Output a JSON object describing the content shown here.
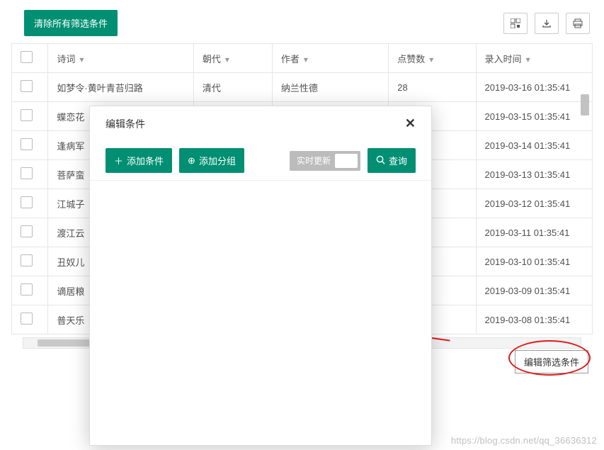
{
  "toolbar": {
    "clear_filters": "清除所有筛选条件"
  },
  "columns": {
    "poem": "诗词",
    "dynasty": "朝代",
    "author": "作者",
    "likes": "点赞数",
    "time": "录入时间"
  },
  "rows": [
    {
      "poem": "如梦令·黄叶青苔归路",
      "dynasty": "清代",
      "author": "纳兰性德",
      "likes": "28",
      "time": "2019-03-16 01:35:41"
    },
    {
      "poem": "蝶恋花",
      "dynasty": "",
      "author": "",
      "likes": "",
      "time": "2019-03-15 01:35:41"
    },
    {
      "poem": "逢病军",
      "dynasty": "",
      "author": "",
      "likes": "",
      "time": "2019-03-14 01:35:41"
    },
    {
      "poem": "菩萨蛮",
      "dynasty": "",
      "author": "",
      "likes": "",
      "time": "2019-03-13 01:35:41"
    },
    {
      "poem": "江城子",
      "dynasty": "",
      "author": "",
      "likes": "",
      "time": "2019-03-12 01:35:41"
    },
    {
      "poem": "渡江云",
      "dynasty": "",
      "author": "",
      "likes": "",
      "time": "2019-03-11 01:35:41"
    },
    {
      "poem": "丑奴儿",
      "dynasty": "",
      "author": "",
      "likes": "",
      "time": "2019-03-10 01:35:41"
    },
    {
      "poem": "谪居粮",
      "dynasty": "",
      "author": "",
      "likes": "",
      "time": "2019-03-09 01:35:41"
    },
    {
      "poem": "普天乐",
      "dynasty": "",
      "author": "",
      "likes": "",
      "time": "2019-03-08 01:35:41"
    }
  ],
  "tooltip": {
    "edit_filter": "编辑筛选条件"
  },
  "modal": {
    "title": "编辑条件",
    "add_condition": "添加条件",
    "add_group": "添加分组",
    "realtime": "实时更新",
    "search": "查询"
  },
  "watermark": "https://blog.csdn.net/qq_36636312"
}
